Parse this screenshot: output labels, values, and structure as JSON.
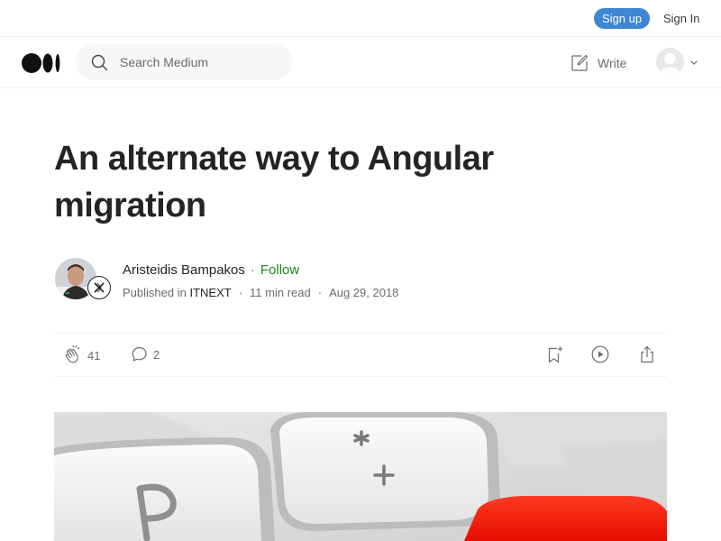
{
  "topbar": {
    "signup_label": "Sign up",
    "signin_label": "Sign In"
  },
  "navbar": {
    "logo_icon": "medium-logo-icon",
    "search": {
      "placeholder": "Search Medium",
      "value": "",
      "icon": "search-icon"
    },
    "write_label": "Write",
    "write_icon": "write-icon"
  },
  "article": {
    "title": "An alternate way to Angular migration",
    "author": {
      "name": "Aristeidis Bampakos",
      "follow_label": "Follow",
      "separator": "·"
    },
    "meta": {
      "published_prefix": "Published in",
      "publication": "ITNEXT",
      "read_time": "11 min read",
      "date": "Aug 29, 2018",
      "separator": "·"
    },
    "actions": {
      "claps": "41",
      "responses": "2"
    }
  },
  "colors": {
    "accent": "#3f86d4",
    "follow": "#1a8917",
    "hero_key_red": "#ff1a0a"
  }
}
